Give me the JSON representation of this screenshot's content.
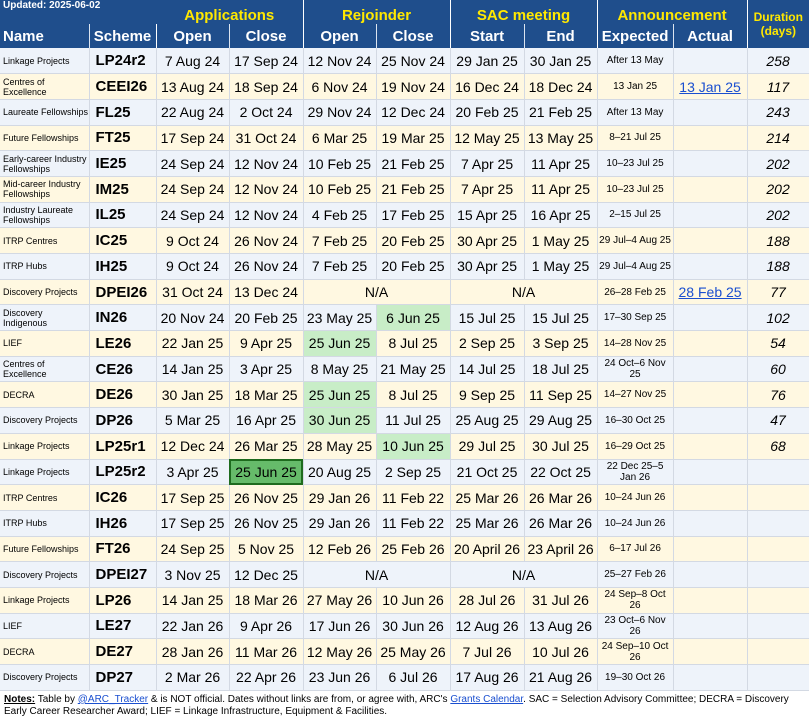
{
  "header": {
    "updated": "Updated: 2025-06-02",
    "groups": {
      "applications": "Applications",
      "rejoinder": "Rejoinder",
      "sac": "SAC meeting",
      "announcement": "Announcement",
      "duration": "Duration (days)"
    },
    "cols": {
      "name": "Name",
      "scheme": "Scheme",
      "app_open": "Open",
      "app_close": "Close",
      "rej_open": "Open",
      "rej_close": "Close",
      "sac_start": "Start",
      "sac_end": "End",
      "expected": "Expected",
      "actual": "Actual"
    }
  },
  "rows": [
    {
      "name": "Linkage Projects",
      "scheme": "LP24r2",
      "ao": "7 Aug 24",
      "ac": "17 Sep 24",
      "ro": "12 Nov 24",
      "rc": "25 Nov 24",
      "ss": "29 Jan 25",
      "se": "30 Jan 25",
      "exp": "After 13 May",
      "act": "",
      "dur": "258"
    },
    {
      "name": "Centres of Excellence",
      "scheme": "CEEI26",
      "ao": "13 Aug 24",
      "ac": "18 Sep 24",
      "ro": "6 Nov 24",
      "rc": "19 Nov 24",
      "ss": "16 Dec 24",
      "se": "18 Dec 24",
      "exp": "13 Jan 25",
      "act": "13 Jan 25",
      "dur": "117"
    },
    {
      "name": "Laureate Fellowships",
      "scheme": "FL25",
      "ao": "22 Aug 24",
      "ac": "2 Oct 24",
      "ro": "29 Nov 24",
      "rc": "12 Dec 24",
      "ss": "20 Feb 25",
      "se": "21 Feb 25",
      "exp": "After 13 May",
      "act": "",
      "dur": "243"
    },
    {
      "name": "Future Fellowships",
      "scheme": "FT25",
      "ao": "17 Sep 24",
      "ac": "31 Oct 24",
      "ro": "6 Mar 25",
      "rc": "19 Mar 25",
      "ss": "12 May 25",
      "se": "13 May 25",
      "exp": "8–21 Jul 25",
      "act": "",
      "dur": "214"
    },
    {
      "name": "Early-career Industry Fellowships",
      "scheme": "IE25",
      "ao": "24 Sep 24",
      "ac": "12 Nov 24",
      "ro": "10 Feb 25",
      "rc": "21 Feb 25",
      "ss": "7 Apr 25",
      "se": "11 Apr 25",
      "exp": "10–23 Jul 25",
      "act": "",
      "dur": "202"
    },
    {
      "name": "Mid-career Industry Fellowships",
      "scheme": "IM25",
      "ao": "24 Sep 24",
      "ac": "12 Nov 24",
      "ro": "10 Feb 25",
      "rc": "21 Feb 25",
      "ss": "7 Apr 25",
      "se": "11 Apr 25",
      "exp": "10–23 Jul 25",
      "act": "",
      "dur": "202"
    },
    {
      "name": "Industry Laureate Fellowships",
      "scheme": "IL25",
      "ao": "24 Sep 24",
      "ac": "12 Nov 24",
      "ro": "4 Feb 25",
      "rc": "17 Feb 25",
      "ss": "15 Apr 25",
      "se": "16 Apr 25",
      "exp": "2–15 Jul 25",
      "act": "",
      "dur": "202"
    },
    {
      "name": "ITRP Centres",
      "scheme": "IC25",
      "ao": "9 Oct 24",
      "ac": "26 Nov 24",
      "ro": "7 Feb 25",
      "rc": "20 Feb 25",
      "ss": "30 Apr 25",
      "se": "1 May 25",
      "exp": "29 Jul–4 Aug 25",
      "act": "",
      "dur": "188"
    },
    {
      "name": "ITRP Hubs",
      "scheme": "IH25",
      "ao": "9 Oct 24",
      "ac": "26 Nov 24",
      "ro": "7 Feb 25",
      "rc": "20 Feb 25",
      "ss": "30 Apr 25",
      "se": "1 May 25",
      "exp": "29 Jul–4 Aug 25",
      "act": "",
      "dur": "188"
    },
    {
      "name": "Discovery Projects",
      "scheme": "DPEI26",
      "ao": "31 Oct 24",
      "ac": "13 Dec 24",
      "rej_na": "N/A",
      "sac_na": "N/A",
      "exp": "26–28 Feb 25",
      "act": "28 Feb 25",
      "dur": "77"
    },
    {
      "name": "Discovery Indigenous",
      "scheme": "IN26",
      "ao": "20 Nov 24",
      "ac": "20 Feb 25",
      "ro": "23 May 25",
      "rc": "6 Jun 25",
      "ss": "15 Jul 25",
      "se": "15 Jul 25",
      "exp": "17–30 Sep 25",
      "act": "",
      "dur": "102"
    },
    {
      "name": "LIEF",
      "scheme": "LE26",
      "ao": "22 Jan 25",
      "ac": "9 Apr 25",
      "ro": "25 Jun 25",
      "rc": "8 Jul 25",
      "ss": "2 Sep 25",
      "se": "3 Sep 25",
      "exp": "14–28 Nov 25",
      "act": "",
      "dur": "54"
    },
    {
      "name": "Centres of Excellence",
      "scheme": "CE26",
      "ao": "14 Jan 25",
      "ac": "3 Apr 25",
      "ro": "8 May 25",
      "rc": "21 May 25",
      "ss": "14 Jul 25",
      "se": "18 Jul 25",
      "exp": "24 Oct–6 Nov 25",
      "act": "",
      "dur": "60"
    },
    {
      "name": "DECRA",
      "scheme": "DE26",
      "ao": "30 Jan 25",
      "ac": "18 Mar 25",
      "ro": "25 Jun 25",
      "rc": "8 Jul 25",
      "ss": "9 Sep 25",
      "se": "11 Sep 25",
      "exp": "14–27 Nov 25",
      "act": "",
      "dur": "76"
    },
    {
      "name": "Discovery Projects",
      "scheme": "DP26",
      "ao": "5 Mar 25",
      "ac": "16 Apr 25",
      "ro": "30 Jun 25",
      "rc": "11 Jul 25",
      "ss": "25 Aug 25",
      "se": "29 Aug 25",
      "exp": "16–30 Oct 25",
      "act": "",
      "dur": "47"
    },
    {
      "name": "Linkage Projects",
      "scheme": "LP25r1",
      "ao": "12 Dec 24",
      "ac": "26 Mar 25",
      "ro": "28 May 25",
      "rc": "10 Jun 25",
      "ss": "29 Jul 25",
      "se": "30 Jul 25",
      "exp": "16–29 Oct 25",
      "act": "",
      "dur": "68"
    },
    {
      "name": "Linkage Projects",
      "scheme": "LP25r2",
      "ao": "3 Apr 25",
      "ac": "25 Jun 25",
      "ro": "20 Aug 25",
      "rc": "2 Sep 25",
      "ss": "21 Oct 25",
      "se": "22 Oct 25",
      "exp": "22 Dec 25–5 Jan 26",
      "act": "",
      "dur": ""
    },
    {
      "name": "ITRP Centres",
      "scheme": "IC26",
      "ao": "17 Sep 25",
      "ac": "26 Nov 25",
      "ro": "29 Jan 26",
      "rc": "11 Feb 22",
      "ss": "25 Mar 26",
      "se": "26 Mar 26",
      "exp": "10–24 Jun 26",
      "act": "",
      "dur": ""
    },
    {
      "name": "ITRP Hubs",
      "scheme": "IH26",
      "ao": "17 Sep 25",
      "ac": "26 Nov 25",
      "ro": "29 Jan 26",
      "rc": "11 Feb 22",
      "ss": "25 Mar 26",
      "se": "26 Mar 26",
      "exp": "10–24 Jun 26",
      "act": "",
      "dur": ""
    },
    {
      "name": "Future Fellowships",
      "scheme": "FT26",
      "ao": "24 Sep 25",
      "ac": "5 Nov 25",
      "ro": "12 Feb 26",
      "rc": "25 Feb 26",
      "ss": "20 April 26",
      "se": "23 April 26",
      "exp": "6–17 Jul 26",
      "act": "",
      "dur": ""
    },
    {
      "name": "Discovery Projects",
      "scheme": "DPEI27",
      "ao": "3 Nov 25",
      "ac": "12 Dec 25",
      "rej_na": "N/A",
      "sac_na": "N/A",
      "exp": "25–27 Feb 26",
      "act": "",
      "dur": ""
    },
    {
      "name": "Linkage Projects",
      "scheme": "LP26",
      "ao": "14 Jan 25",
      "ac": "18 Mar 26",
      "ro": "27 May 26",
      "rc": "10 Jun 26",
      "ss": "28 Jul 26",
      "se": "31 Jul 26",
      "exp": "24 Sep–8 Oct 26",
      "act": "",
      "dur": ""
    },
    {
      "name": "LIEF",
      "scheme": "LE27",
      "ao": "22 Jan 26",
      "ac": "9 Apr 26",
      "ro": "17 Jun 26",
      "rc": "30 Jun 26",
      "ss": "12 Aug 26",
      "se": "13 Aug 26",
      "exp": "23 Oct–6 Nov 26",
      "act": "",
      "dur": ""
    },
    {
      "name": "DECRA",
      "scheme": "DE27",
      "ao": "28 Jan 26",
      "ac": "11 Mar 26",
      "ro": "12 May 26",
      "rc": "25 May 26",
      "ss": "7 Jul 26",
      "se": "10 Jul 26",
      "exp": "24 Sep–10 Oct 26",
      "act": "",
      "dur": ""
    },
    {
      "name": "Discovery Projects",
      "scheme": "DP27",
      "ao": "2 Mar 26",
      "ac": "22 Apr 26",
      "ro": "23 Jun 26",
      "rc": "6 Jul 26",
      "ss": "17 Aug 26",
      "se": "21 Aug 26",
      "exp": "19–30 Oct 26",
      "act": "",
      "dur": ""
    }
  ],
  "notes": {
    "label": "Notes:",
    "t1": " Table by ",
    "author": "@ARC_Tracker",
    "t2": " & is NOT official. Dates without links are from, or agree with, ARC's ",
    "calendar": "Grants Calendar",
    "t3": ". SAC = Selection Advisory Committee; DECRA = Discovery Early Career Researcher Award; LIEF = Linkage Infrastructure, Equipment & Facilities."
  },
  "colors": {
    "header_bg": "#1f4e8c",
    "group_text": "#ffe800",
    "row_blue": "#eef3fa",
    "row_yellow": "#fff8e1",
    "highlight_green": "#c8edc7",
    "current_green": "#66bb6a",
    "link": "#1a4fd0"
  }
}
